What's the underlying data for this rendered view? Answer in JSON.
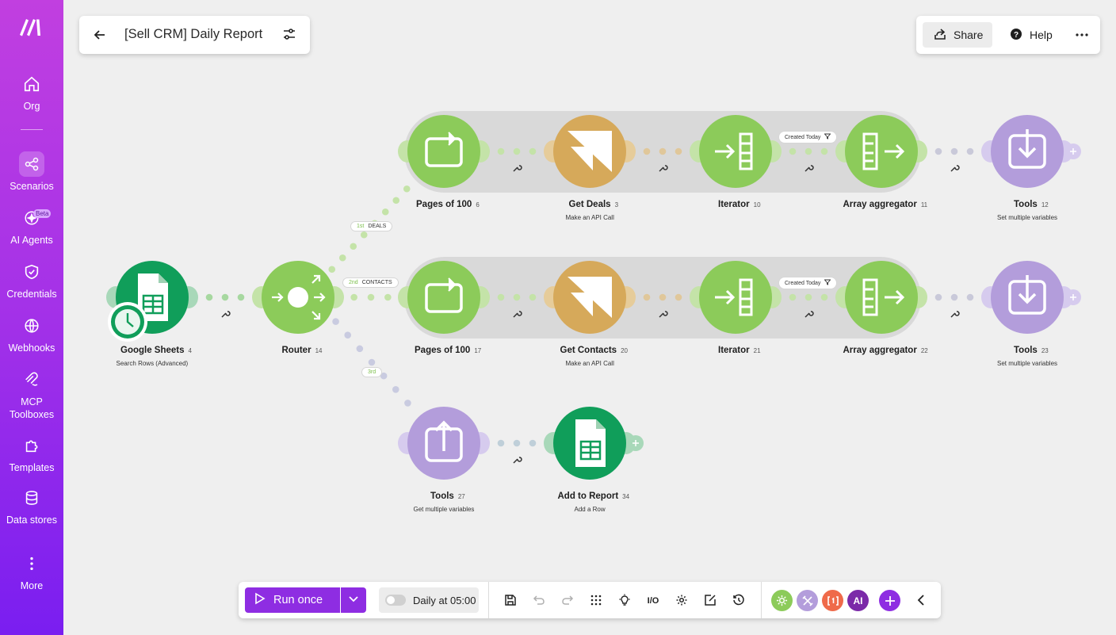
{
  "sidebar": {
    "items": [
      {
        "label": "Org",
        "icon": "home-icon"
      },
      {
        "label": "Scenarios",
        "icon": "share-nodes-icon"
      },
      {
        "label": "AI Agents",
        "icon": "ai-agents-icon",
        "badge": "Beta"
      },
      {
        "label": "Credentials",
        "icon": "shield-check-icon"
      },
      {
        "label": "Webhooks",
        "icon": "globe-icon"
      },
      {
        "label": "MCP Toolboxes",
        "icon": "mcp-icon"
      },
      {
        "label": "Templates",
        "icon": "puzzle-icon"
      },
      {
        "label": "Data stores",
        "icon": "database-icon"
      },
      {
        "label": "More",
        "icon": "more-vertical-icon"
      }
    ],
    "active": "Scenarios"
  },
  "header": {
    "title": "[Sell CRM] Daily Report"
  },
  "topright": {
    "share_label": "Share",
    "help_label": "Help"
  },
  "modules": [
    {
      "name": "Google Sheets",
      "num": "4",
      "sub": "Search Rows (Advanced)"
    },
    {
      "name": "Router",
      "num": "14",
      "sub": ""
    },
    {
      "name": "Pages of 100",
      "num": "6",
      "sub": ""
    },
    {
      "name": "Get Deals",
      "num": "3",
      "sub": "Make an API Call"
    },
    {
      "name": "Iterator",
      "num": "10",
      "sub": ""
    },
    {
      "name": "Array aggregator",
      "num": "11",
      "sub": ""
    },
    {
      "name": "Tools",
      "num": "12",
      "sub": "Set multiple variables"
    },
    {
      "name": "Pages of 100",
      "num": "17",
      "sub": ""
    },
    {
      "name": "Get Contacts",
      "num": "20",
      "sub": "Make an API Call"
    },
    {
      "name": "Iterator",
      "num": "21",
      "sub": ""
    },
    {
      "name": "Array aggregator",
      "num": "22",
      "sub": ""
    },
    {
      "name": "Tools",
      "num": "23",
      "sub": "Set multiple variables"
    },
    {
      "name": "Tools",
      "num": "27",
      "sub": "Get multiple variables"
    },
    {
      "name": "Add to Report",
      "num": "34",
      "sub": "Add a Row"
    }
  ],
  "routes": [
    {
      "order": "1st",
      "label": "DEALS"
    },
    {
      "order": "2nd",
      "label": "CONTACTS"
    },
    {
      "order": "3rd",
      "label": ""
    }
  ],
  "filters": [
    "Created Today",
    "Created Today"
  ],
  "toolbar": {
    "run_label": "Run once",
    "schedule_label": "Daily at 05:00",
    "avatars": [
      "AI"
    ]
  },
  "colors": {
    "green": "#8ccb5a",
    "gold": "#d6a95a",
    "purple": "#b39ddb",
    "sheets": "#109e5a",
    "accent": "#8e2de2"
  }
}
